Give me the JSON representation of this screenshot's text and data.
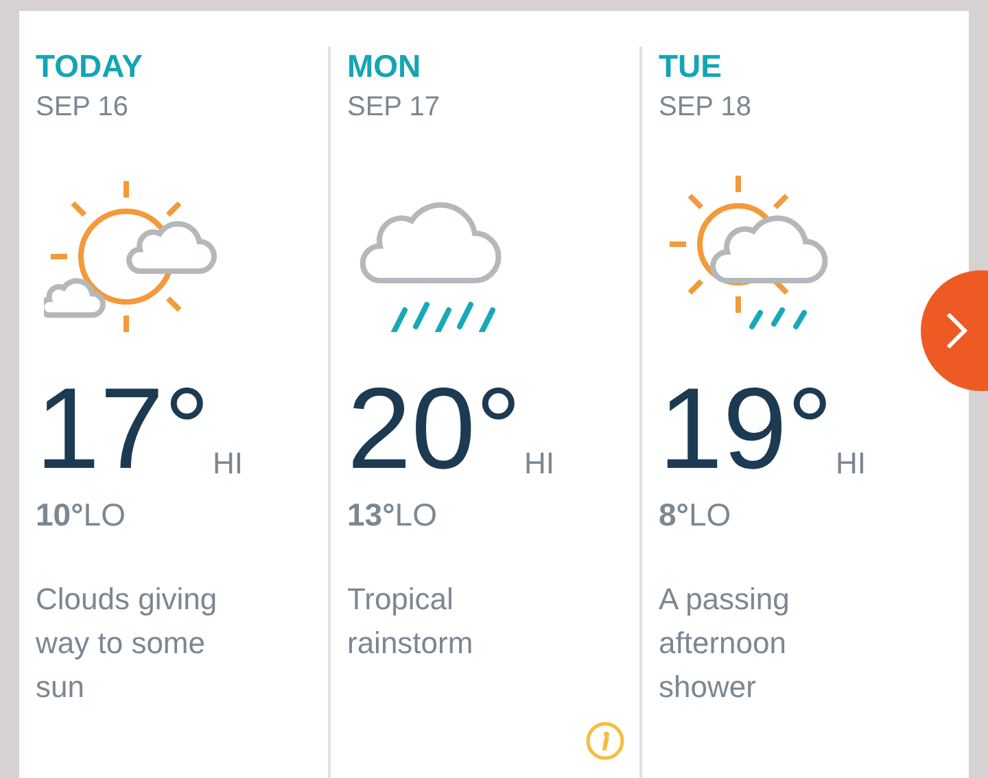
{
  "days": [
    {
      "day": "TODAY",
      "date": "SEP 16",
      "kind": "sun_clouds",
      "hi": "17°",
      "hi_label": "HI",
      "lo": "10°",
      "lo_label": "LO",
      "summary": "Clouds giving way to some sun",
      "info": false
    },
    {
      "day": "MON",
      "date": "SEP 17",
      "kind": "rain",
      "hi": "20°",
      "hi_label": "HI",
      "lo": "13°",
      "lo_label": "LO",
      "summary": "Tropical rainstorm",
      "info": true
    },
    {
      "day": "TUE",
      "date": "SEP 18",
      "kind": "sun_cloud_showers",
      "hi": "19°",
      "hi_label": "HI",
      "lo": "8°",
      "lo_label": "LO",
      "summary": "A passing afternoon shower",
      "info": false
    }
  ],
  "next_button": true
}
